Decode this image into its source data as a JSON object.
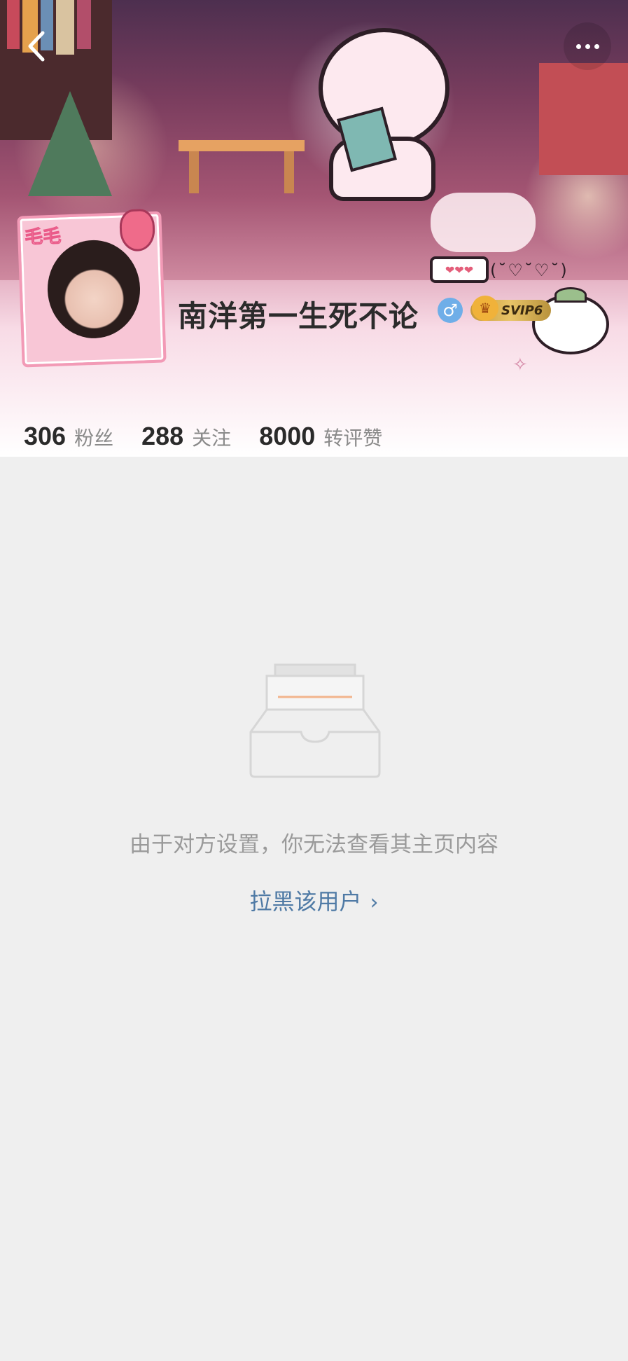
{
  "nav": {
    "back_icon": "chevron-left-icon",
    "more_icon": "ellipsis-icon"
  },
  "profile": {
    "username": "南洋第一生死不论",
    "gender_symbol": "♂",
    "vip_label": "SVIP6",
    "avatar_frame_text": "毛毛",
    "deco_bubble": "❤❤❤",
    "deco_hearts": "(˘♡˘♡˘)"
  },
  "stats": [
    {
      "value": "306",
      "label": "粉丝"
    },
    {
      "value": "288",
      "label": "关注"
    },
    {
      "value": "8000",
      "label": "转评赞"
    }
  ],
  "empty_state": {
    "icon": "inbox-tray-icon",
    "message": "由于对方设置，你无法查看其主页内容",
    "link_label": "拉黑该用户",
    "link_chevron": "›"
  },
  "colors": {
    "background": "#efefef",
    "link": "#4f7aa5",
    "muted_text": "#9a9a9a",
    "vip_gold": "#e8c467",
    "gender_blue": "#6faee8"
  }
}
